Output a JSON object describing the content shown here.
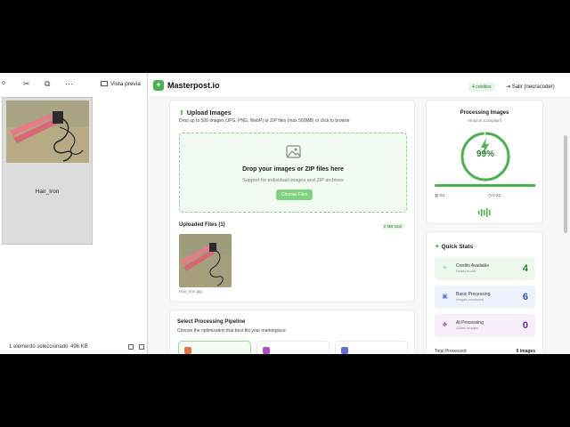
{
  "explorer": {
    "toolbar_left": "o",
    "vista_previa": "Vista previa",
    "file_name": "Hair_Iron",
    "status_selected": "1 elemento seleccionado",
    "status_size": "496 KB"
  },
  "app": {
    "brand": "Masterpost.io",
    "credits_badge": "4 créditos",
    "logout": "Salir (neuracoder)",
    "upload": {
      "title": "Upload Images",
      "subtitle": "Drop up to 500 images (JPG, PNG, WebP) or ZIP files (max 500MB) or click to browse",
      "drop_title": "Drop your images or ZIP files here",
      "drop_subtitle": "Support for individual images and ZIP archives",
      "choose_button": "Choose Files",
      "uploaded_title": "Uploaded Files (1)",
      "total_size": "0 MB total",
      "file_name": "Hair_Iron.jpg"
    },
    "pipeline": {
      "title": "Select Processing Pipeline",
      "subtitle": "Choose the optimization that best fits your marketplace"
    },
    "processing": {
      "title": "Processing Images",
      "subtitle": "Amazon Compliant",
      "percent_label": "99%",
      "progress": 0.99,
      "left_stat": "0/1",
      "right_stat": "0:22"
    },
    "stats": {
      "title": "Quick Stats",
      "items": [
        {
          "label": "Credits Available",
          "sub": "Ready to use",
          "value": "4"
        },
        {
          "label": "Basic Processing",
          "sub": "Images processed",
          "value": "6"
        },
        {
          "label": "AI Processing",
          "sub": "Queen images",
          "value": "0"
        }
      ],
      "total_label": "Total Processed",
      "total_value": "6 images"
    }
  },
  "colors": {
    "accent": "#4caf50",
    "dropzone_bg": "#f1fbf1",
    "stat1_bg": "#eef9ee",
    "stat2_bg": "#eef3fb",
    "stat3_bg": "#f6eef9"
  },
  "icons": {
    "cut": "scissors-icon",
    "copy": "copy-icon",
    "more": "more-icon",
    "logo": "leaf-icon",
    "upload": "upload-icon",
    "image": "image-icon",
    "bolt": "bolt-icon",
    "sparkle": "sparkle-icon"
  }
}
